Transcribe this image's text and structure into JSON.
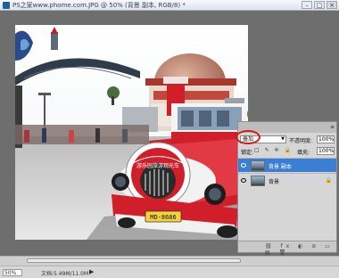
{
  "window": {
    "title": "PS之家www.phome.com.JPG @ 50% (背景 副本, RGB/8) *",
    "buttons": {
      "minimize": "–",
      "maximize": "□",
      "close": "×"
    }
  },
  "statusbar": {
    "zoom": "50%",
    "doc": "文档:5.49M/11.0M",
    "arrow": "▶"
  },
  "image": {
    "sign_text": "游乐园旅游观光车",
    "plate": "MD-8686"
  },
  "layers_panel": {
    "blend_mode": "叠加",
    "opacity_label": "不透明度:",
    "opacity_value": "100%",
    "lock_label": "锁定:",
    "lock_icons": "□ ✎ ✢ 🔒",
    "fill_label": "填充:",
    "fill_value": "100%",
    "layers": [
      {
        "name": "背景 副本",
        "selected": true,
        "locked": false
      },
      {
        "name": "背景",
        "selected": false,
        "locked": true
      }
    ],
    "bottom_icons": "⛓ fx ◐ ⊘ ▭ ▤ 🗑"
  },
  "colors": {
    "selected_layer": "#3a7fd5",
    "highlight_circle": "#d21a1a",
    "train_red": "#d01f2a",
    "dome": "#c98a74"
  }
}
